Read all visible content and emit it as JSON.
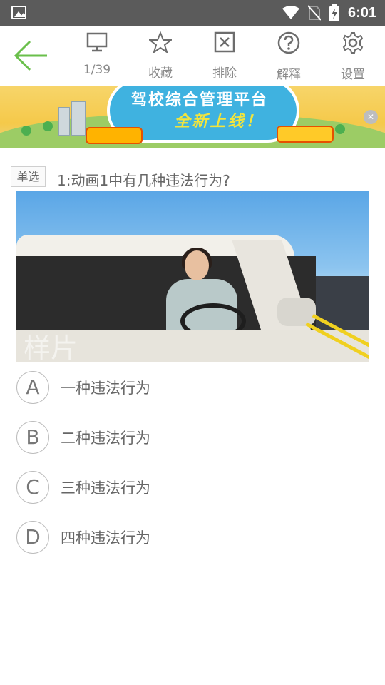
{
  "status_bar": {
    "time": "6:01",
    "icons": [
      "gallery-icon",
      "wifi-icon",
      "no-sim-icon",
      "battery-charging-icon"
    ]
  },
  "toolbar": {
    "back_icon": "arrow-left-icon",
    "items": [
      {
        "label": "1/39",
        "icon": "monitor-icon"
      },
      {
        "label": "收藏",
        "icon": "star-icon"
      },
      {
        "label": "排除",
        "icon": "x-box-icon"
      },
      {
        "label": "解释",
        "icon": "question-circle-icon"
      },
      {
        "label": "设置",
        "icon": "gear-icon"
      }
    ],
    "accent_color": "#6abf4b"
  },
  "banner": {
    "title": "驾校综合管理平台",
    "subtitle": "全新上线！"
  },
  "question": {
    "type": "单选",
    "text": "1:动画1中有几种违法行为?",
    "image_watermark": "样片"
  },
  "options": [
    {
      "letter": "A",
      "text": "一种违法行为"
    },
    {
      "letter": "B",
      "text": "二种违法行为"
    },
    {
      "letter": "C",
      "text": "三种违法行为"
    },
    {
      "letter": "D",
      "text": "四种违法行为"
    }
  ]
}
